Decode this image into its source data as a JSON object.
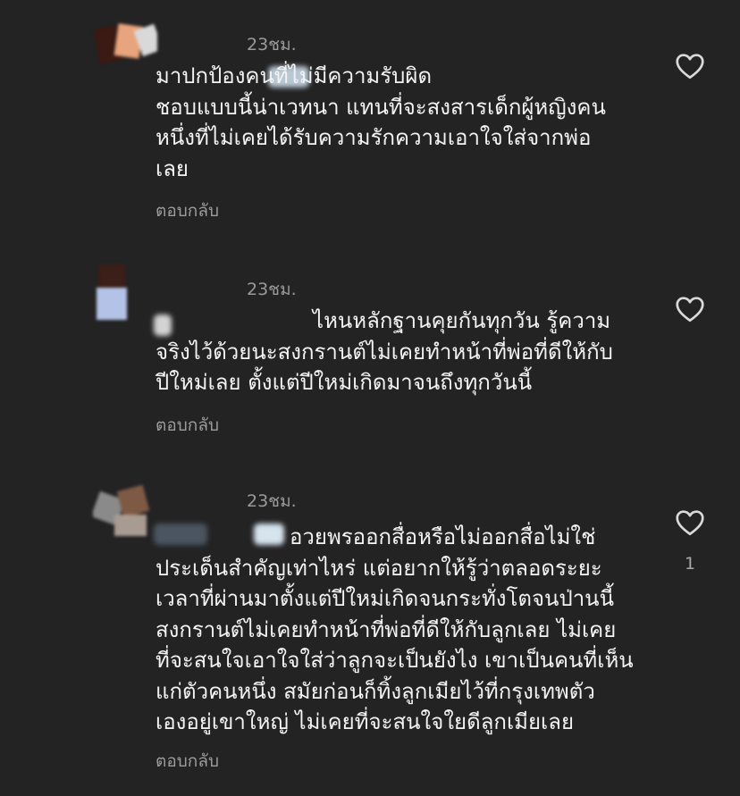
{
  "comments": [
    {
      "time": "23ชม.",
      "text": "มาปกป้องคนที่ไม่มีความรับผิด\nชอบแบบนี้น่าเวทนา แทนที่จะสงสารเด็กผู้หญิงคน\nหนึ่งที่ไม่เคยได้รับความรักความเอาใจใส่จากพ่อ\nเลย",
      "reply_label": "ตอบกลับ",
      "like_count": ""
    },
    {
      "time": "23ชม.",
      "text": "ไหนหลักฐานคุยกันทุกวัน รู้ความ\nจริงไว้ด้วยนะสงกรานต์ไม่เคยทำหน้าที่พ่อที่ดีให้กับ\nปีใหม่เลย ตั้งแต่ปีใหม่เกิดมาจนถึงทุกวันนี้",
      "reply_label": "ตอบกลับ",
      "like_count": ""
    },
    {
      "time": "23ชม.",
      "text": "อวยพรออกสื่อหรือไม่ออกสื่อไม่ใช่\nประเด็นสำคัญเท่าไหร่ แต่อยากให้รู้ว่าตลอดระยะ\nเวลาที่ผ่านมาตั้งแต่ปีใหม่เกิดจนกระทั่งโตจนป่านนี้\nสงกรานต์ไม่เคยทำหน้าที่พ่อที่ดีให้กับลูกเลย ไม่เคย\nที่จะสนใจเอาใจใส่ว่าลูกจะเป็นยังไง เขาเป็นคนที่เห็น\nแก่ตัวคนหนึ่ง สมัยก่อนก็ทิ้งลูกเมียไว้ที่กรุงเทพตัว\nเองอยู่เขาใหญ่ ไม่เคยที่จะสนใจใยดีลูกเมียเลย",
      "reply_label": "ตอบกลับ",
      "like_count": "1"
    }
  ],
  "icons": {
    "like": "heart-outline-icon"
  },
  "colors": {
    "background": "#232324",
    "text": "#f3f3f3",
    "muted": "#9c9c9c"
  }
}
